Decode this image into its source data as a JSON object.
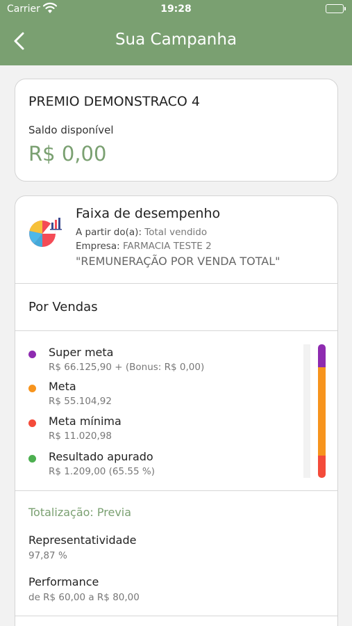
{
  "status": {
    "carrier": "Carrier",
    "time": "19:28"
  },
  "nav": {
    "title": "Sua Campanha",
    "back_icon": "chevron-left-icon"
  },
  "campaign": {
    "name": "PREMIO DEMONSTRACO 4",
    "balance_label": "Saldo disponível",
    "balance_value": "R$ 0,00"
  },
  "performance": {
    "title": "Faixa de desempenho",
    "from_label": "A partir do(a):",
    "from_value": "Total vendido",
    "company_label": "Empresa:",
    "company_value": "FARMACIA TESTE 2",
    "remuneration": "\"REMUNERAÇÃO POR VENDA TOTAL\"",
    "section_title": "Por Vendas",
    "goals": [
      {
        "name": "Super meta",
        "value": "R$ 66.125,90 + (Bonus: R$ 0,00)",
        "color": "#8e2bb0"
      },
      {
        "name": "Meta",
        "value": "R$ 55.104,92",
        "color": "#f7941d"
      },
      {
        "name": "Meta mínima",
        "value": "R$ 11.020,98",
        "color": "#f44b3a"
      },
      {
        "name": "Resultado apurado",
        "value": "R$ 1.209,00  (65.55 %)",
        "color": "#4caf50"
      }
    ],
    "progress_fractions": {
      "super_meta": 0.17,
      "meta": 0.66,
      "meta_minima": 0.17
    }
  },
  "totalization": {
    "title": "Totalização: Previa",
    "representatividade_label": "Representatividade",
    "representatividade_value": "97,87 %",
    "performance_label": "Performance",
    "performance_value": "de R$ 60,00 a R$ 80,00"
  },
  "colors": {
    "accent": "#7aa071"
  }
}
